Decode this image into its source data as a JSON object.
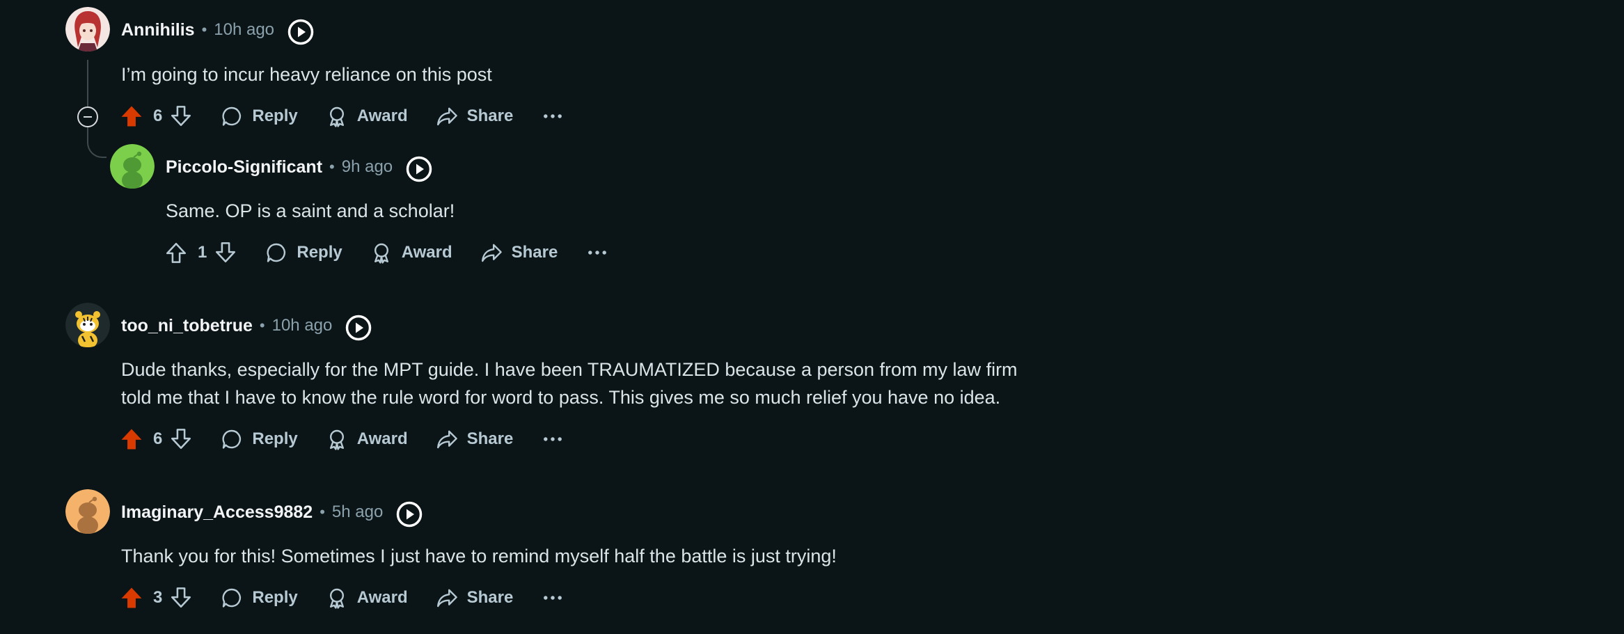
{
  "colors": {
    "background": "#0b1416",
    "upvote_active": "#d93a00",
    "text_muted": "#8ba2ad",
    "action_text": "#b7cad4"
  },
  "comments": [
    {
      "username": "Annihilis",
      "time": "10h ago",
      "body": "I’m going to incur heavy reliance on this post",
      "score": "6",
      "upvoted": true,
      "avatar": "anime-avatar",
      "actions": {
        "reply": "Reply",
        "award": "Award",
        "share": "Share"
      }
    },
    {
      "username": "Piccolo-Significant",
      "time": "9h ago",
      "body": "Same. OP is a saint and a scholar!",
      "score": "1",
      "upvoted": false,
      "avatar": "green-snoo-avatar",
      "actions": {
        "reply": "Reply",
        "award": "Award",
        "share": "Share"
      }
    },
    {
      "username": "too_ni_tobetrue",
      "time": "10h ago",
      "body_lines": [
        "Dude thanks, especially for the MPT guide. I have been TRAUMATIZED because a person from my law firm",
        "told me that I have to know the rule word for word to pass. This gives me so much relief you have no idea."
      ],
      "score": "6",
      "upvoted": true,
      "avatar": "tiger-snoo-avatar",
      "actions": {
        "reply": "Reply",
        "award": "Award",
        "share": "Share"
      }
    },
    {
      "username": "Imaginary_Access9882",
      "time": "5h ago",
      "body": "Thank you for this! Sometimes I just have to remind myself half the battle is just trying!",
      "score": "3",
      "upvoted": true,
      "avatar": "orange-snoo-avatar",
      "actions": {
        "reply": "Reply",
        "award": "Award",
        "share": "Share"
      }
    }
  ]
}
